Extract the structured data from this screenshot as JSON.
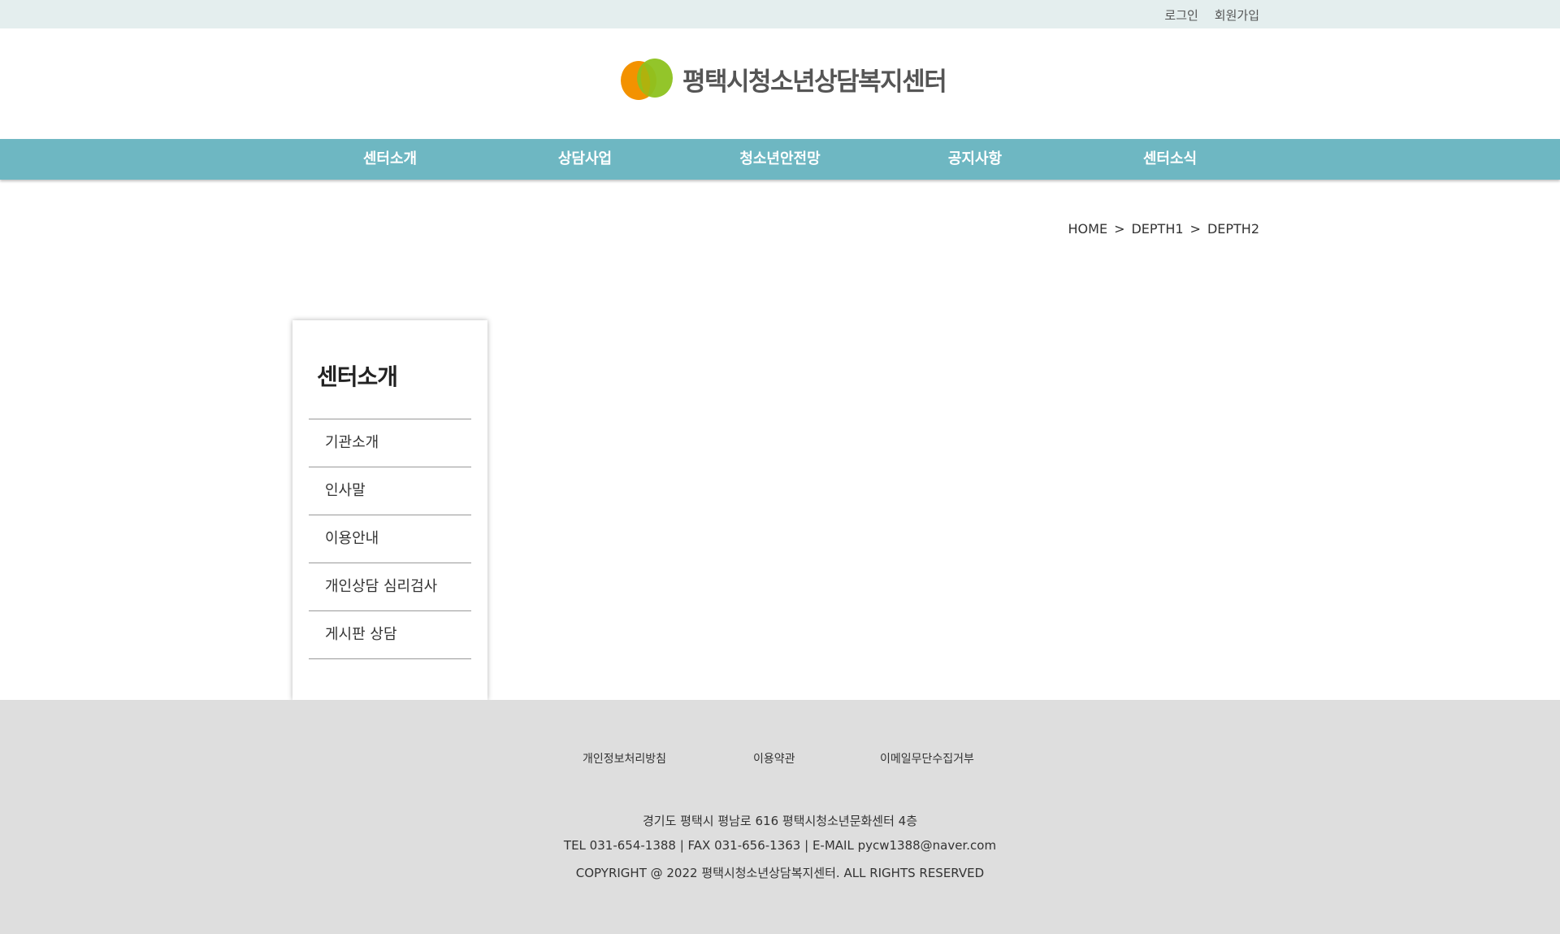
{
  "topbar": {
    "login": "로그인",
    "signup": "회원가입"
  },
  "logo": {
    "text": "평택시청소년상담복지센터"
  },
  "gnb": [
    "센터소개",
    "상담사업",
    "청소년안전망",
    "공지사항",
    "센터소식"
  ],
  "breadcrumb": {
    "home": "HOME",
    "sep1": ">",
    "depth1": "DEPTH1",
    "sep2": ">",
    "depth2": "DEPTH2"
  },
  "lnb": {
    "title": "센터소개",
    "items": [
      "기관소개",
      "인사말",
      "이용안내",
      "개인상담 심리검사",
      "게시판 상담"
    ]
  },
  "footer": {
    "links": [
      "개인정보처리방침",
      "이용약관",
      "이메일무단수집거부"
    ],
    "address": "경기도 평택시 평남로 616 평택시청소년문화센터 4층",
    "contact": "TEL 031-654-1388 | FAX 031-656-1363 | E-MAIL pycw1388@naver.com",
    "copyright": "COPYRIGHT @ 2022 평택시청소년상담복지센터. ALL RIGHTS RESERVED"
  },
  "colors": {
    "gnb": "#6eb7c2",
    "topbar": "#e4eeee",
    "footer": "#dedede",
    "logo_orange": "#f39200",
    "logo_green": "#8dc21f"
  }
}
